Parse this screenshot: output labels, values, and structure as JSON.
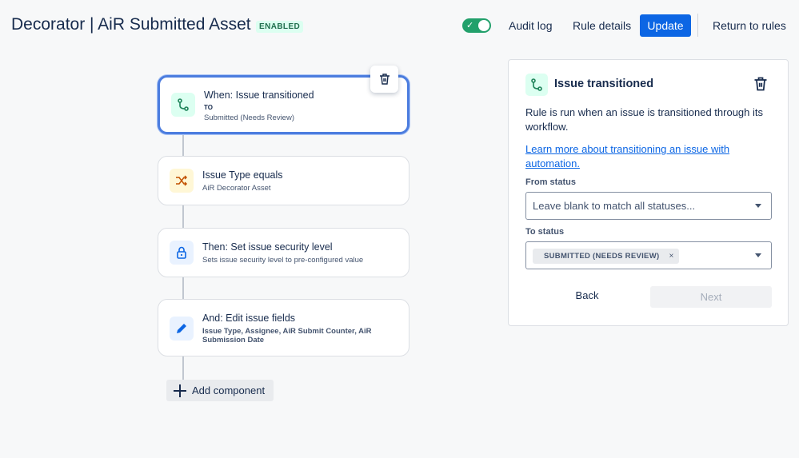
{
  "header": {
    "title": "Decorator | AiR Submitted Asset",
    "status_badge": "ENABLED",
    "toggle_check": "✓",
    "audit_log": "Audit log",
    "rule_details": "Rule details",
    "update": "Update",
    "return_to_rules": "Return to rules"
  },
  "colors": {
    "accent": "#0c66e4",
    "enabled_green": "#22a06b",
    "selected_border": "#4c7ddf"
  },
  "flow": {
    "components": [
      {
        "icon": "branch-icon",
        "title": "When: Issue transitioned",
        "to_label": "TO",
        "subtitle": "Submitted (Needs Review)"
      },
      {
        "icon": "shuffle-icon",
        "title": "Issue Type equals",
        "subtitle": "AiR Decorator Asset"
      },
      {
        "icon": "lock-icon",
        "title": "Then: Set issue security level",
        "subtitle": "Sets issue security level to pre-configured value"
      },
      {
        "icon": "pencil-icon",
        "title": "And: Edit issue fields",
        "subtitle": "Issue Type, Assignee, AiR Submit Counter, AiR Submission Date"
      }
    ],
    "add_component": "Add component"
  },
  "panel": {
    "icon": "branch-icon",
    "title": "Issue transitioned",
    "description": "Rule is run when an issue is transitioned through its workflow.",
    "learn_more": "Learn more about transitioning an issue with automation.",
    "from_status": {
      "label": "From status",
      "placeholder": "Leave blank to match all statuses..."
    },
    "to_status": {
      "label": "To status",
      "selected": "SUBMITTED (NEEDS REVIEW)",
      "remove": "×"
    },
    "back": "Back",
    "next": "Next"
  }
}
